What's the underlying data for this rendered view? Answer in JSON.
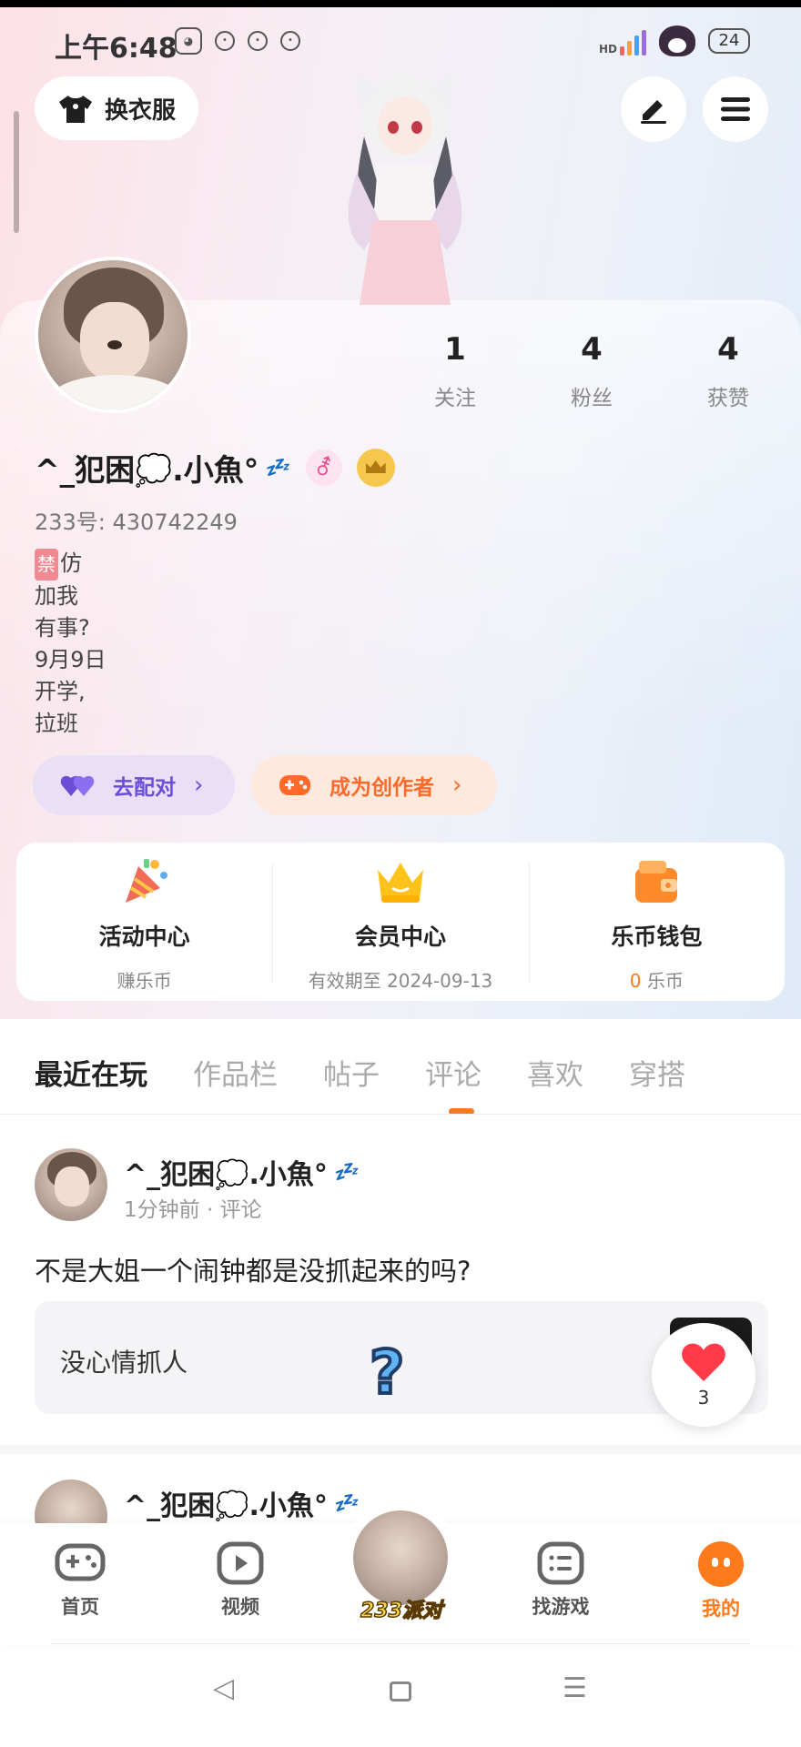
{
  "status_bar": {
    "time": "上午6:48",
    "battery": "24",
    "network": "HD"
  },
  "header": {
    "outfit_label": "换衣服"
  },
  "profile": {
    "stats": [
      {
        "value": "1",
        "label": "关注"
      },
      {
        "value": "4",
        "label": "粉丝"
      },
      {
        "value": "4",
        "label": "获赞"
      }
    ],
    "name": "^_犯困💭.小魚°",
    "zzz": "💤",
    "gender_symbol": "⚦",
    "uid": "233号: 430742249",
    "bio_forbid": "禁",
    "bio_lines": [
      "仿",
      "加我",
      "有事?",
      "9月9日",
      "开学,",
      "拉班"
    ],
    "match_label": "去配对",
    "creator_label": "成为创作者"
  },
  "entries": [
    {
      "title": "活动中心",
      "sub": "赚乐币"
    },
    {
      "title": "会员中心",
      "sub": "有效期至 2024-09-13"
    },
    {
      "title": "乐币钱包",
      "sub_value": "0",
      "sub_unit": "乐币"
    }
  ],
  "tabs": [
    "最近在玩",
    "作品栏",
    "帖子",
    "评论",
    "喜欢",
    "穿搭"
  ],
  "post": {
    "name": "^_犯困💭.小魚°",
    "meta": "1分钟前 · 评论",
    "text": "不是大姐一个闹钟都是没抓起来的吗?",
    "quote": "没心情抓人",
    "like_count": "3"
  },
  "post2": {
    "name": "^_犯困💭.小魚°"
  },
  "bottom_nav": {
    "home": "首页",
    "video": "视频",
    "party": "233派对",
    "find": "找游戏",
    "mine": "我的"
  },
  "colors": {
    "accent": "#ff7a1a",
    "match": "#6a4fd6",
    "like": "#ff3b4a"
  }
}
